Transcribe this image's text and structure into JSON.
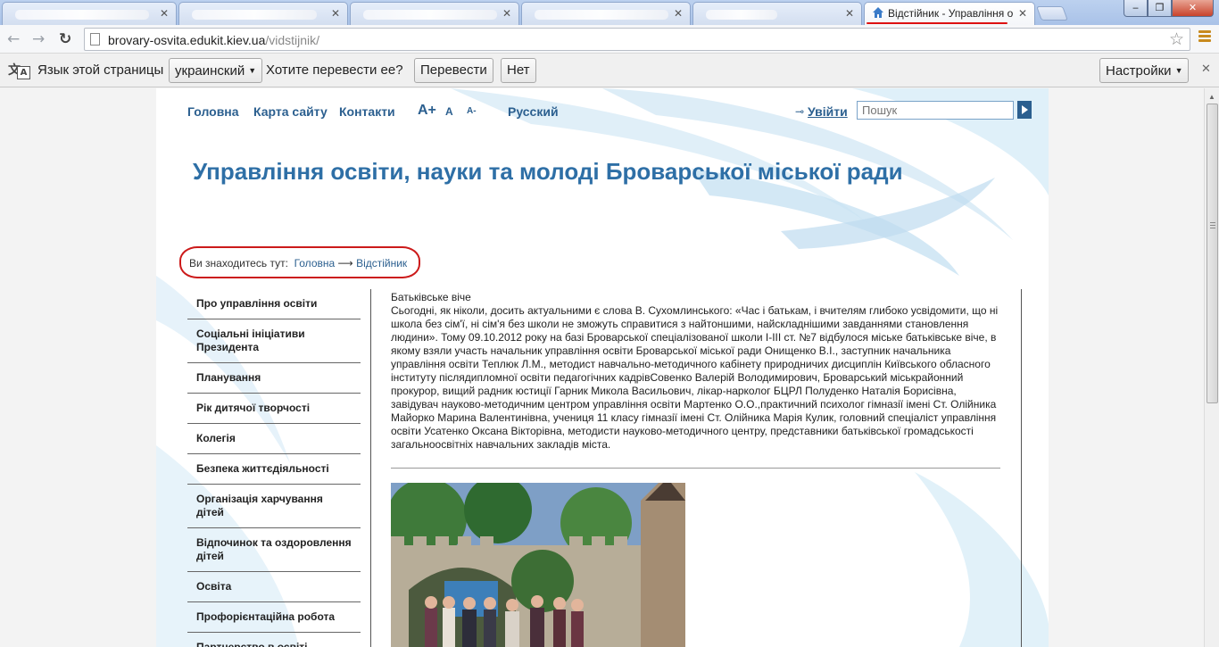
{
  "browser": {
    "active_tab_title": "Відстійник - Управління освіти",
    "url_host": "brovary-osvita.edukit.kiev.ua",
    "url_path": "/vidstijnik/"
  },
  "translate_bar": {
    "prompt": "Язык этой страницы",
    "language": "украинский",
    "question": "Хотите перевести ее?",
    "translate_label": "Перевести",
    "no_label": "Нет",
    "settings_label": "Настройки"
  },
  "site": {
    "nav": [
      "Головна",
      "Карта сайту",
      "Контакти"
    ],
    "font_sizes": [
      "A+",
      "A",
      "A-"
    ],
    "language_link": "Русский",
    "login_label": "Увійти",
    "search_placeholder": "Пошук",
    "title": "Управління освіти, науки та молоді Броварської міської ради",
    "breadcrumb": {
      "prefix": "Ви знаходитесь тут:",
      "home": "Головна",
      "separator": "⟶",
      "current": "Відстійник"
    },
    "sidebar": [
      "Про управління освіти",
      "Соціальні ініціативи Президента",
      "Планування",
      "Рік дитячої творчості",
      "Колегія",
      "Безпека життєдіяльності",
      "Організація харчування дітей",
      "Відпочинок та оздоровлення дітей",
      "Освіта",
      "Профорієнтаційна робота",
      "Партнерство в освіті"
    ],
    "article": {
      "heading": "Батьківське віче",
      "body": "Сьогодні, як ніколи, досить актуальними є слова В. Сухомлинського: «Час і батькам, і вчителям глибоко усвідомити, що ні школа без сім'ї, ні сім'я без школи не зможуть справитися з найтоншими, найскладнішими завданнями становлення людини». Тому 09.10.2012 року на базі Броварської спеціалізованої школи І-ІІІ ст. №7 відбулося міське батьківське віче, в якому взяли участь начальник управління освіти Броварської міської ради Онищенко В.І., заступник начальника управління освіти Теплюк Л.М., методист навчально-методичного кабінету природничих дисциплін Київського обласного інституту післядипломної освіти педагогічних кадрівСовенко Валерій Володимирович, Броварський міськрайонний прокурор, вищий радник юстиції Гарник Микола Васильович, лікар-нарколог БЦРЛ Полуденко Наталія Борисівна, завідувач науково-методичним центром управління освіти Мартенко О.О.,практичний психолог гімназії імені Ст. Олійника Майорко Марина Валентинівна, учениця 11 класу гімназії імені Ст. Олійника Марія Кулик, головний спеціаліст управління освіти Усатенко Оксана Вікторівна, методисти науково-методичного центру, представники батьківської громадськості загальноосвітніх навчальних закладів міста."
    }
  },
  "colors": {
    "link_blue": "#2b5f8f",
    "title_blue": "#2e6fa6",
    "annotation_red": "#cc1a1a"
  }
}
